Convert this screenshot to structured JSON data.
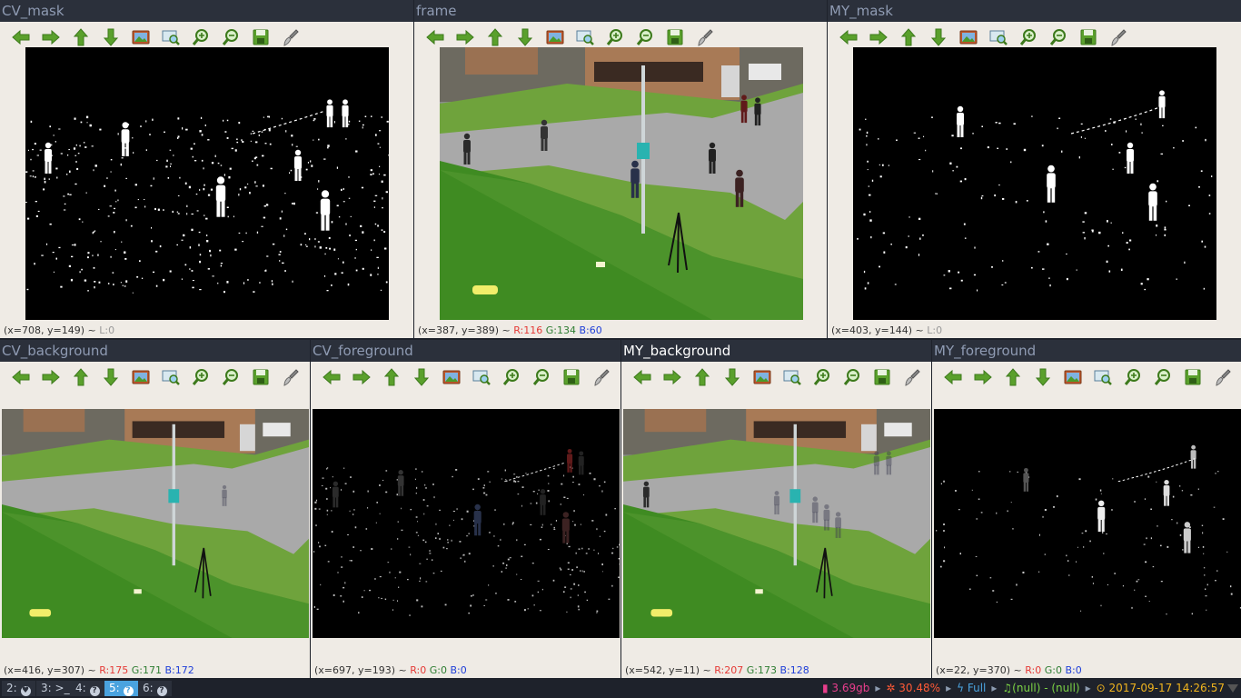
{
  "windows": [
    {
      "id": "cv-mask",
      "title": "CV_mask",
      "status": {
        "coords": "(x=708, y=149)",
        "sep": " ~ ",
        "l": "L:0"
      }
    },
    {
      "id": "frame",
      "title": "frame",
      "status": {
        "coords": "(x=387, y=389)",
        "sep": " ~ ",
        "r": "R:116",
        "g": "G:134",
        "b": "B:60"
      }
    },
    {
      "id": "my-mask",
      "title": "MY_mask",
      "status": {
        "coords": "(x=403, y=144)",
        "sep": " ~ ",
        "l": "L:0"
      }
    },
    {
      "id": "cv-background",
      "title": "CV_background",
      "status": {
        "coords": "(x=416, y=307)",
        "sep": " ~ ",
        "r": "R:175",
        "g": "G:171",
        "b": "B:172"
      }
    },
    {
      "id": "cv-foreground",
      "title": "CV_foreground",
      "status": {
        "coords": "(x=697, y=193)",
        "sep": " ~ ",
        "r": "R:0",
        "g": "G:0",
        "b": "B:0"
      }
    },
    {
      "id": "my-background",
      "title": "MY_background",
      "status": {
        "coords": "(x=542, y=11)",
        "sep": " ~ ",
        "r": "R:207",
        "g": "G:173",
        "b": "B:128"
      }
    },
    {
      "id": "my-foreground",
      "title": "MY_foreground",
      "status": {
        "coords": "(x=22, y=370)",
        "sep": " ~ ",
        "r": "R:0",
        "g": "G:0",
        "b": "B:0"
      }
    }
  ],
  "toolbar_icons": [
    "arrow-left-icon",
    "arrow-right-icon",
    "arrow-up-icon",
    "arrow-down-icon",
    "image-icon",
    "zoom-region-icon",
    "zoom-in-icon",
    "zoom-out-icon",
    "save-icon",
    "brush-icon"
  ],
  "colors": {
    "toolbar_green": "#5aa02c",
    "panel_bg": "#efebe5",
    "title_bg": "#2b303b",
    "accent": "#4aa3df"
  },
  "taskbar": {
    "workspaces": [
      {
        "label": "2:",
        "icon": "♥"
      },
      {
        "label": "3:",
        "icon": ">_"
      },
      {
        "label": "4:",
        "icon": "?"
      },
      {
        "label": "5:",
        "icon": "?"
      },
      {
        "label": "6:",
        "icon": "?"
      }
    ],
    "memory": "3.69gb",
    "cpu": "30.48%",
    "battery": "Full",
    "music": "(null) - (null)",
    "datetime": "2017-09-17 14:26:57"
  }
}
